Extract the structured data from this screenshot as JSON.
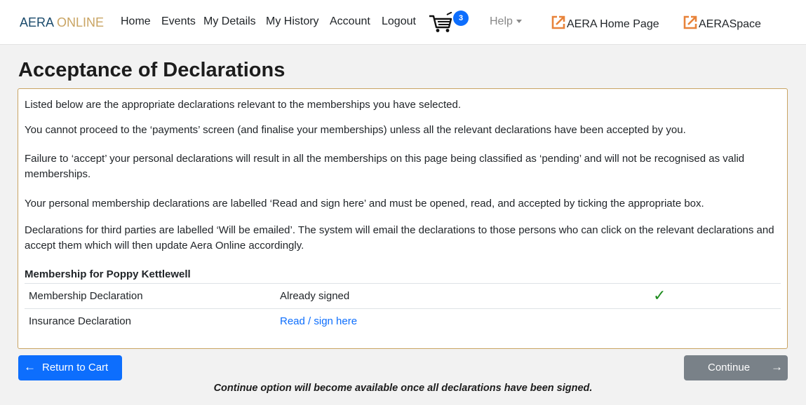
{
  "nav": {
    "brand_part1": "AERA",
    "brand_part2": "ONLINE",
    "links": [
      "Home",
      "Events",
      "My Details",
      "My History",
      "Account",
      "Logout"
    ],
    "cart_count": "3",
    "help_label": "Help",
    "external_links": [
      "AERA Home Page",
      "AERASpace"
    ]
  },
  "page": {
    "title": "Acceptance of Declarations"
  },
  "panel": {
    "paragraphs": [
      "Listed below are the appropriate declarations relevant to the memberships you have selected.",
      "You cannot proceed to the ‘payments’ screen (and finalise your memberships) unless all the relevant declarations have been accepted by you.",
      "Failure to ‘accept’ your personal declarations will result in all the memberships on this page being classified as ‘pending’ and will not be recognised as valid memberships.",
      "Your personal membership declarations are labelled ‘Read and sign here’ and must be opened, read, and accepted by ticking the appropriate box.",
      "Declarations for third parties are labelled ‘Will be emailed’. The system will email the declarations to those persons who can click on the relevant declarations and accept them which will then update Aera Online accordingly."
    ],
    "membership_heading": "Membership for Poppy Kettlewell",
    "declarations": [
      {
        "name": "Membership Declaration",
        "status": "Already signed",
        "signed": true
      },
      {
        "name": "Insurance Declaration",
        "status": "Read / sign here",
        "signed": false
      }
    ]
  },
  "actions": {
    "back_label": "Return to Cart",
    "continue_label": "Continue",
    "footnote": "Continue option will become available once all declarations have been signed."
  },
  "colors": {
    "brand_dark": "#1a4a6b",
    "brand_gold": "#c9a463",
    "primary": "#0d6efd",
    "disabled": "#6c757d",
    "success": "#1e8c1e",
    "external_icon": "#e8833a"
  }
}
